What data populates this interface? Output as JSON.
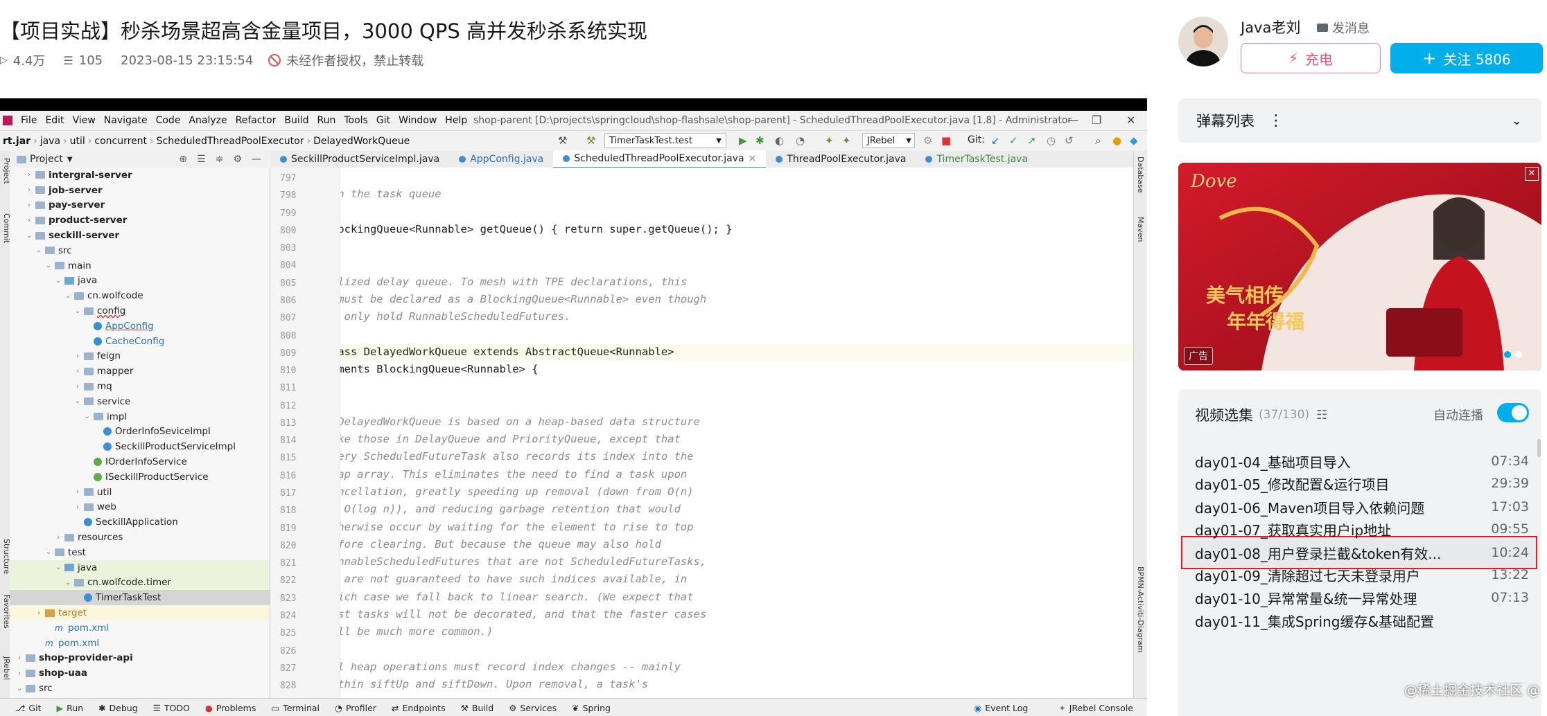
{
  "header": {
    "title": "【项目实战】秒杀场景超高含金量项目，3000 QPS 高并发秒杀系统实现",
    "views": "4.4万",
    "danmaku_count": "105",
    "date": "2023-08-15 23:15:54",
    "copyright": "未经作者授权，禁止转载"
  },
  "ide": {
    "menu": [
      "File",
      "Edit",
      "View",
      "Navigate",
      "Code",
      "Analyze",
      "Refactor",
      "Build",
      "Run",
      "Tools",
      "Git",
      "Window",
      "Help"
    ],
    "window_title": "shop-parent [D:\\projects\\springcloud\\shop-flashsale\\shop-parent] - ScheduledThreadPoolExecutor.java [1.8] - Administrator",
    "breadcrumbs": [
      "rt.jar",
      "java",
      "util",
      "concurrent",
      "ScheduledThreadPoolExecutor",
      "DelayedWorkQueue"
    ],
    "run_config": "TimerTaskTest.test",
    "jrebel": "JRebel",
    "git_label": "Git:",
    "project_label": "Project",
    "tree": [
      {
        "label": "intergral-server",
        "depth": 1,
        "type": "module",
        "arrow": "›",
        "bold": true
      },
      {
        "label": "job-server",
        "depth": 1,
        "type": "module",
        "arrow": "›",
        "bold": true
      },
      {
        "label": "pay-server",
        "depth": 1,
        "type": "module",
        "arrow": "›",
        "bold": true
      },
      {
        "label": "product-server",
        "depth": 1,
        "type": "module",
        "arrow": "›",
        "bold": true
      },
      {
        "label": "seckill-server",
        "depth": 1,
        "type": "module",
        "arrow": "⌄",
        "bold": true
      },
      {
        "label": "src",
        "depth": 2,
        "type": "folder",
        "arrow": "⌄"
      },
      {
        "label": "main",
        "depth": 3,
        "type": "folder",
        "arrow": "⌄"
      },
      {
        "label": "java",
        "depth": 4,
        "type": "src",
        "arrow": "⌄"
      },
      {
        "label": "cn.wolfcode",
        "depth": 5,
        "type": "folder",
        "arrow": "⌄"
      },
      {
        "label": "config",
        "depth": 6,
        "type": "folder",
        "arrow": "⌄",
        "underline": true
      },
      {
        "label": "AppConfig",
        "depth": 7,
        "type": "class",
        "arrow": "",
        "link": true
      },
      {
        "label": "CacheConfig",
        "depth": 7,
        "type": "class",
        "arrow": "",
        "blue": true
      },
      {
        "label": "feign",
        "depth": 6,
        "type": "folder",
        "arrow": "›"
      },
      {
        "label": "mapper",
        "depth": 6,
        "type": "folder",
        "arrow": "›"
      },
      {
        "label": "mq",
        "depth": 6,
        "type": "folder",
        "arrow": "›"
      },
      {
        "label": "service",
        "depth": 6,
        "type": "folder",
        "arrow": "⌄"
      },
      {
        "label": "impl",
        "depth": 7,
        "type": "folder",
        "arrow": "⌄"
      },
      {
        "label": "OrderInfoSeviceImpl",
        "depth": 8,
        "type": "class",
        "arrow": ""
      },
      {
        "label": "SeckillProductServiceImpl",
        "depth": 8,
        "type": "class",
        "arrow": ""
      },
      {
        "label": "IOrderInfoService",
        "depth": 7,
        "type": "iface",
        "arrow": ""
      },
      {
        "label": "ISeckillProductService",
        "depth": 7,
        "type": "iface",
        "arrow": ""
      },
      {
        "label": "util",
        "depth": 6,
        "type": "folder",
        "arrow": "›"
      },
      {
        "label": "web",
        "depth": 6,
        "type": "folder",
        "arrow": "›"
      },
      {
        "label": "SeckillApplication",
        "depth": 6,
        "type": "class",
        "arrow": ""
      },
      {
        "label": "resources",
        "depth": 4,
        "type": "folder",
        "arrow": "›"
      },
      {
        "label": "test",
        "depth": 3,
        "type": "folder",
        "arrow": "⌄"
      },
      {
        "label": "java",
        "depth": 4,
        "type": "src",
        "arrow": "⌄",
        "green": true
      },
      {
        "label": "cn.wolfcode.timer",
        "depth": 5,
        "type": "folder",
        "arrow": "⌄",
        "green": true
      },
      {
        "label": "TimerTaskTest",
        "depth": 6,
        "type": "class",
        "arrow": "",
        "selected": true
      },
      {
        "label": "target",
        "depth": 2,
        "type": "orange",
        "arrow": "›",
        "yellow": true
      },
      {
        "label": "pom.xml",
        "depth": 3,
        "type": "pom",
        "arrow": ""
      },
      {
        "label": "pom.xml",
        "depth": 2,
        "type": "pom",
        "arrow": ""
      },
      {
        "label": "shop-provider-api",
        "depth": 0,
        "type": "module",
        "arrow": "›",
        "bold": true
      },
      {
        "label": "shop-uaa",
        "depth": 0,
        "type": "module",
        "arrow": "›",
        "bold": true
      },
      {
        "label": "src",
        "depth": 0,
        "type": "folder",
        "arrow": "⌄"
      }
    ],
    "tabs": [
      {
        "label": "SeckillProductServiceImpl.java",
        "active": false
      },
      {
        "label": "AppConfig.java",
        "active": false
      },
      {
        "label": "ScheduledThreadPoolExecutor.java",
        "active": true
      },
      {
        "label": "ThreadPoolExecutor.java",
        "active": false
      },
      {
        "label": "TimerTaskTest.java",
        "active": false
      }
    ],
    "code_lines": [
      {
        "n": "797",
        "text": "     *",
        "kind": "cmt"
      },
      {
        "n": "798",
        "text": "     * @return the task queue",
        "kind": "cmt"
      },
      {
        "n": "799",
        "text": "     */",
        "kind": "cmt"
      },
      {
        "n": "800",
        "text": "    public BlockingQueue<Runnable> getQueue() { return super.getQueue(); }",
        "kind": "code"
      },
      {
        "n": "803",
        "text": "",
        "kind": "code"
      },
      {
        "n": "804",
        "text": "    /**",
        "kind": "cmt"
      },
      {
        "n": "805",
        "text": "     * Specialized delay queue. To mesh with TPE declarations, this",
        "kind": "cmt"
      },
      {
        "n": "806",
        "text": "     * class must be declared as a BlockingQueue<Runnable> even though",
        "kind": "cmt"
      },
      {
        "n": "807",
        "text": "     * it can only hold RunnableScheduledFutures.",
        "kind": "cmt"
      },
      {
        "n": "808",
        "text": "     */",
        "kind": "cmt"
      },
      {
        "n": "809",
        "text": "    static class DelayedWorkQueue extends AbstractQueue<Runnable>",
        "kind": "code",
        "current": true
      },
      {
        "n": "810",
        "text": "        implements BlockingQueue<Runnable> {",
        "kind": "code"
      },
      {
        "n": "811",
        "text": "",
        "kind": "code"
      },
      {
        "n": "812",
        "text": "        /*",
        "kind": "cmt"
      },
      {
        "n": "813",
        "text": "         * A DelayedWorkQueue is based on a heap-based data structure",
        "kind": "cmt"
      },
      {
        "n": "814",
        "text": "         * like those in DelayQueue and PriorityQueue, except that",
        "kind": "cmt"
      },
      {
        "n": "815",
        "text": "         * every ScheduledFutureTask also records its index into the",
        "kind": "cmt"
      },
      {
        "n": "816",
        "text": "         * heap array. This eliminates the need to find a task upon",
        "kind": "cmt"
      },
      {
        "n": "817",
        "text": "         * cancellation, greatly speeding up removal (down from O(n)",
        "kind": "cmt"
      },
      {
        "n": "818",
        "text": "         * to O(log n)), and reducing garbage retention that would",
        "kind": "cmt"
      },
      {
        "n": "819",
        "text": "         * otherwise occur by waiting for the element to rise to top",
        "kind": "cmt"
      },
      {
        "n": "820",
        "text": "         * before clearing. But because the queue may also hold",
        "kind": "cmt"
      },
      {
        "n": "821",
        "text": "         * RunnableScheduledFutures that are not ScheduledFutureTasks,",
        "kind": "cmt"
      },
      {
        "n": "822",
        "text": "         * we are not guaranteed to have such indices available, in",
        "kind": "cmt"
      },
      {
        "n": "823",
        "text": "         * which case we fall back to linear search. (We expect that",
        "kind": "cmt"
      },
      {
        "n": "824",
        "text": "         * most tasks will not be decorated, and that the faster cases",
        "kind": "cmt"
      },
      {
        "n": "825",
        "text": "         * will be much more common.)",
        "kind": "cmt"
      },
      {
        "n": "826",
        "text": "         *",
        "kind": "cmt"
      },
      {
        "n": "827",
        "text": "         * All heap operations must record index changes -- mainly",
        "kind": "cmt"
      },
      {
        "n": "828",
        "text": "         * within siftUp and siftDown. Upon removal, a task's",
        "kind": "cmt"
      }
    ],
    "right_tools": [
      "Database",
      "Maven",
      "BPMN-Activiti-Diagram"
    ],
    "left_tools": [
      "Project",
      "Commit",
      "Structure",
      "Favorites",
      "JRebel"
    ],
    "status": [
      "Git",
      "Run",
      "Debug",
      "TODO",
      "Problems",
      "Terminal",
      "Profiler",
      "Endpoints",
      "Build",
      "Services",
      "Spring"
    ],
    "status_right": [
      "Event Log",
      "JRebel Console"
    ]
  },
  "sidebar": {
    "author": "Java老刘",
    "message": "发消息",
    "charge": "充电",
    "follow": "关注 5806",
    "danmaku_list": "弹幕列表",
    "ad_label": "广告",
    "ad_slogan_1": "美气相传",
    "ad_slogan_2": "年年得福",
    "ad_brand": "Dove",
    "playlist_title": "视频选集",
    "playlist_count": "(37/130)",
    "autoplay": "自动连播",
    "episodes": [
      {
        "title": "day01-04_基础项目导入",
        "duration": "07:34"
      },
      {
        "title": "day01-05_修改配置&运行项目",
        "duration": "29:39"
      },
      {
        "title": "day01-06_Maven项目导入依赖问题",
        "duration": "17:03"
      },
      {
        "title": "day01-07_获取真实用户ip地址",
        "duration": "09:55"
      },
      {
        "title": "day01-08_用户登录拦截&token有效...",
        "duration": "10:24",
        "selected": true
      },
      {
        "title": "day01-09_清除超过七天未登录用户",
        "duration": "13:22"
      },
      {
        "title": "day01-10_异常常量&统一异常处理",
        "duration": "07:13"
      },
      {
        "title": "day01-11_集成Spring缓存&基础配置",
        "duration": ""
      }
    ],
    "watermark": "@稀土掘金技术社区 @ 狠难说"
  },
  "colors": {
    "accent": "#00aeec",
    "pink": "#f0507c",
    "selection_border": "#e02020"
  }
}
